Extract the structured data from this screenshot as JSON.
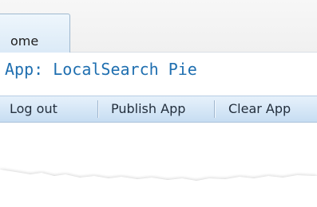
{
  "tabs": {
    "home_label": "ome"
  },
  "app": {
    "title": "App: LocalSearch Pie"
  },
  "toolbar": {
    "logout_label": "Log out",
    "publish_label": "Publish App",
    "clear_label": "Clear App"
  },
  "colors": {
    "title_blue": "#1f6fb0",
    "toolbar_top": "#e6f1fb",
    "toolbar_bottom": "#c7ddf2",
    "tab_fill": "#dbeaf7"
  }
}
